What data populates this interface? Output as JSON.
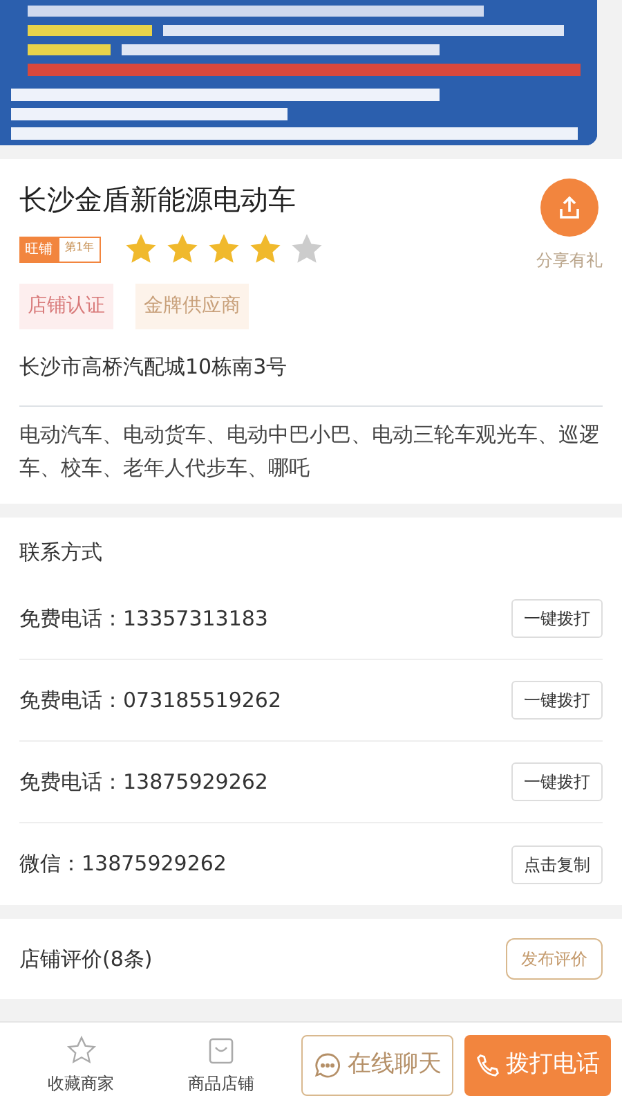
{
  "shop": {
    "name": "长沙金盾新能源电动车",
    "badge_main": "旺铺",
    "badge_year": "第1年",
    "stars": 4,
    "share_label": "分享有礼",
    "tags": [
      "店铺认证",
      "金牌供应商"
    ],
    "address": "长沙市高桥汽配城10栋南3号",
    "business": "电动汽车、电动货车、电动中巴小巴、电动三轮车观光车、巡逻车、校车、老年人代步车、哪吒"
  },
  "contact": {
    "title": "联系方式",
    "rows": [
      {
        "label": "免费电话：",
        "value": "13357313183",
        "action": "一键拨打"
      },
      {
        "label": "免费电话：",
        "value": "073185519262",
        "action": "一键拨打"
      },
      {
        "label": "免费电话：",
        "value": "13875929262",
        "action": "一键拨打"
      },
      {
        "label": "微信：",
        "value": "13875929262",
        "action": "点击复制"
      }
    ]
  },
  "reviews": {
    "title": "店铺评价(8条)",
    "action": "发布评价"
  },
  "bottom_bar": {
    "favorite": "收藏商家",
    "shop": "商品店铺",
    "chat": "在线聊天",
    "call": "拨打电话"
  }
}
